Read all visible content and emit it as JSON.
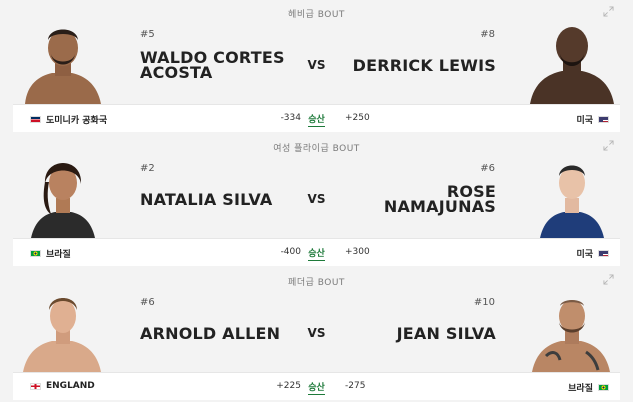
{
  "fights": [
    {
      "weight_class": "헤비급 BOUT",
      "red": {
        "rank": "#5",
        "name": "WALDO CORTES ACOSTA",
        "country": "도미니카 공화국",
        "flag": "dominican-republic",
        "odds": "-334"
      },
      "blue": {
        "rank": "#8",
        "name": "DERRICK LEWIS",
        "country": "미국",
        "flag": "usa",
        "odds": "+250"
      },
      "vs_label": "VS",
      "odds_label": "승산"
    },
    {
      "weight_class": "여성 플라이급 BOUT",
      "red": {
        "rank": "#2",
        "name": "NATALIA SILVA",
        "country": "브라질",
        "flag": "brazil",
        "odds": "-400"
      },
      "blue": {
        "rank": "#6",
        "name": "ROSE NAMAJUNAS",
        "country": "미국",
        "flag": "usa",
        "odds": "+300"
      },
      "vs_label": "VS",
      "odds_label": "승산"
    },
    {
      "weight_class": "페더급 BOUT",
      "red": {
        "rank": "#6",
        "name": "ARNOLD ALLEN",
        "country": "ENGLAND",
        "flag": "england",
        "odds": "+225"
      },
      "blue": {
        "rank": "#10",
        "name": "JEAN SILVA",
        "country": "브라질",
        "flag": "brazil",
        "odds": "-275"
      },
      "vs_label": "VS",
      "odds_label": "승산"
    }
  ],
  "icons": {
    "expand": "expand-arrows-icon",
    "fighter_photo": "fighter-photo"
  },
  "colors": {
    "odds_link": "#1e7a3a",
    "background": "#f3f3f3"
  }
}
